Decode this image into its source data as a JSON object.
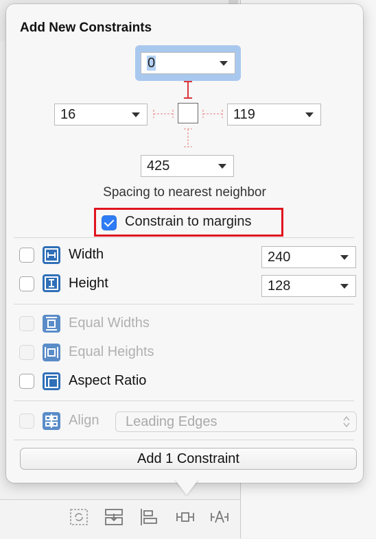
{
  "popover": {
    "title": "Add New Constraints",
    "spacing": {
      "top": "0",
      "leading": "16",
      "trailing": "119",
      "bottom": "425",
      "caption": "Spacing to nearest neighbor"
    },
    "constrain_to_margins": {
      "label": "Constrain to margins",
      "checked": true
    },
    "size": {
      "width_label": "Width",
      "width_value": "240",
      "height_label": "Height",
      "height_value": "128"
    },
    "equal_widths_label": "Equal Widths",
    "equal_heights_label": "Equal Heights",
    "aspect_ratio_label": "Aspect Ratio",
    "align": {
      "label": "Align",
      "value": "Leading Edges"
    },
    "add_button_label": "Add 1 Constraint"
  },
  "colors": {
    "accent": "#2e7cf6",
    "highlight": "#e0141e",
    "strut_active": "#d9343a",
    "strut_inactive": "#f0a8a8",
    "icon_tile": "#2f6fb7"
  },
  "toolbar_icons": [
    "update-frames-icon",
    "stack-icon",
    "align-icon",
    "add-constraints-icon",
    "resolve-issues-icon"
  ]
}
